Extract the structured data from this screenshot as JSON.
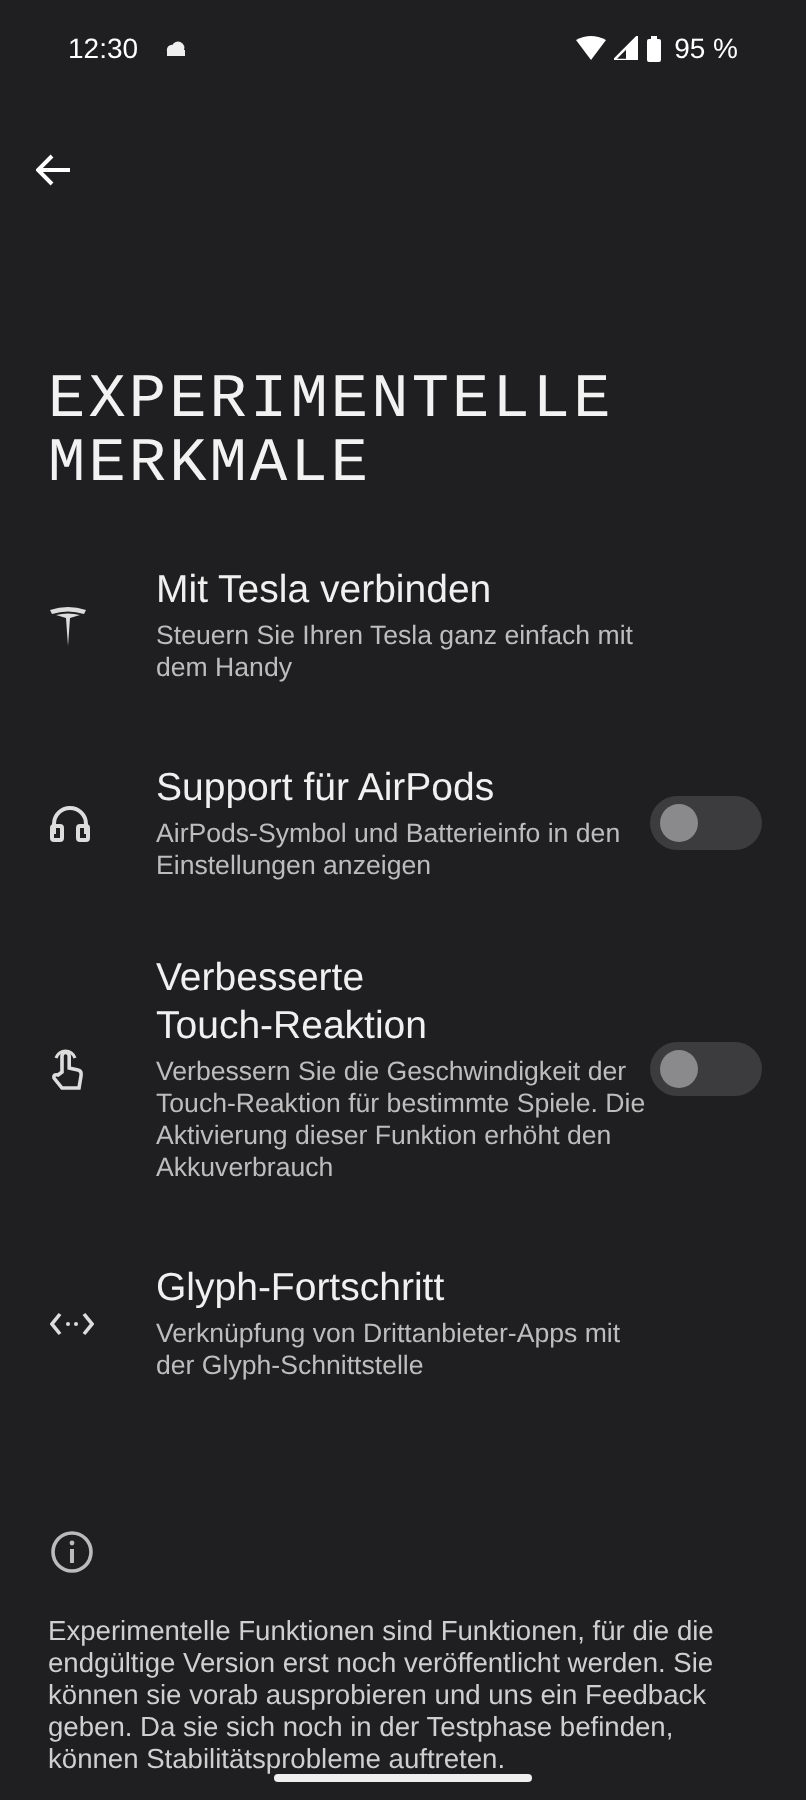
{
  "status_bar": {
    "time": "12:30",
    "battery": "95 %"
  },
  "title": "EXPERIMENTELLE MERKMALE",
  "items": [
    {
      "kind": "link",
      "title": "Mit Tesla verbinden",
      "description": "Steuern Sie Ihren Tesla ganz einfach mit dem Handy"
    },
    {
      "kind": "toggle",
      "title": "Support für AirPods",
      "description": "AirPods-Symbol und Batterieinfo in den Einstellungen anzeigen",
      "on": false
    },
    {
      "kind": "toggle",
      "title": "Verbesserte Touch-Reaktion",
      "description": "Verbessern Sie die Geschwindigkeit der Touch-Reaktion für bestimmte Spiele. Die Aktivierung dieser Funktion erhöht den Akkuverbrauch",
      "on": false
    },
    {
      "kind": "link",
      "title": "Glyph-Fortschritt",
      "description": "Verknüpfung von Drittanbieter-Apps mit der Glyph-Schnittstelle"
    }
  ],
  "footer": "Experimentelle Funktionen sind Funktionen, für die die endgültige Version erst noch veröffentlicht werden. Sie können sie vorab ausprobieren und uns ein Feedback geben. Da sie sich noch in der Testphase befinden, können Stabilitätsprobleme auftreten."
}
